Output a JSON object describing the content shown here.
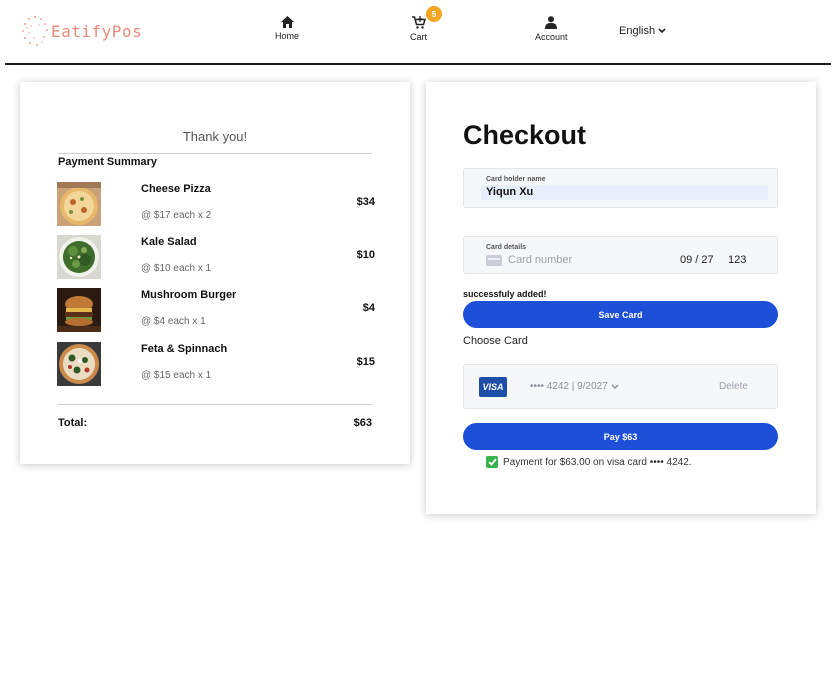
{
  "header": {
    "logo_text": "EatifyPos",
    "nav": {
      "home_label": "Home",
      "cart_label": "Cart",
      "cart_count": "5",
      "account_label": "Account"
    },
    "language": "English"
  },
  "summary": {
    "thanks": "Thank you!",
    "title": "Payment Summary",
    "items": [
      {
        "name": "Cheese Pizza",
        "qty": "@ $17 each x 2",
        "price": "$34",
        "image": "pizza-photo"
      },
      {
        "name": "Kale Salad",
        "qty": "@ $10 each x 1",
        "price": "$10",
        "image": "salad-photo"
      },
      {
        "name": "Mushroom Burger",
        "qty": "@ $4 each x 1",
        "price": "$4",
        "image": "burger-photo"
      },
      {
        "name": "Feta & Spinnach",
        "qty": "@ $15 each x 1",
        "price": "$15",
        "image": "pizza-photo"
      }
    ],
    "total_label": "Total:",
    "total_value": "$63"
  },
  "checkout": {
    "title": "Checkout",
    "card_holder_label": "Card holder name",
    "card_holder_value": "Yiqun Xu",
    "card_details_label": "Card details",
    "card_number_placeholder": "Card number",
    "card_expiry": "09 / 27",
    "card_cvc": "123",
    "success_text": "successfuly added!",
    "save_button": "Save Card",
    "choose_label": "Choose Card",
    "saved_card": {
      "brand": "VISA",
      "text": "•••• 4242 | 9/2027",
      "delete_label": "Delete"
    },
    "pay_button": "Pay $63",
    "payment_message": "Payment for $63.00 on visa card •••• 4242."
  },
  "colors": {
    "primary_button": "#1e4fd8",
    "cart_badge": "#f5a623",
    "logo": "#e98a7a",
    "success_check": "#35b34a"
  }
}
